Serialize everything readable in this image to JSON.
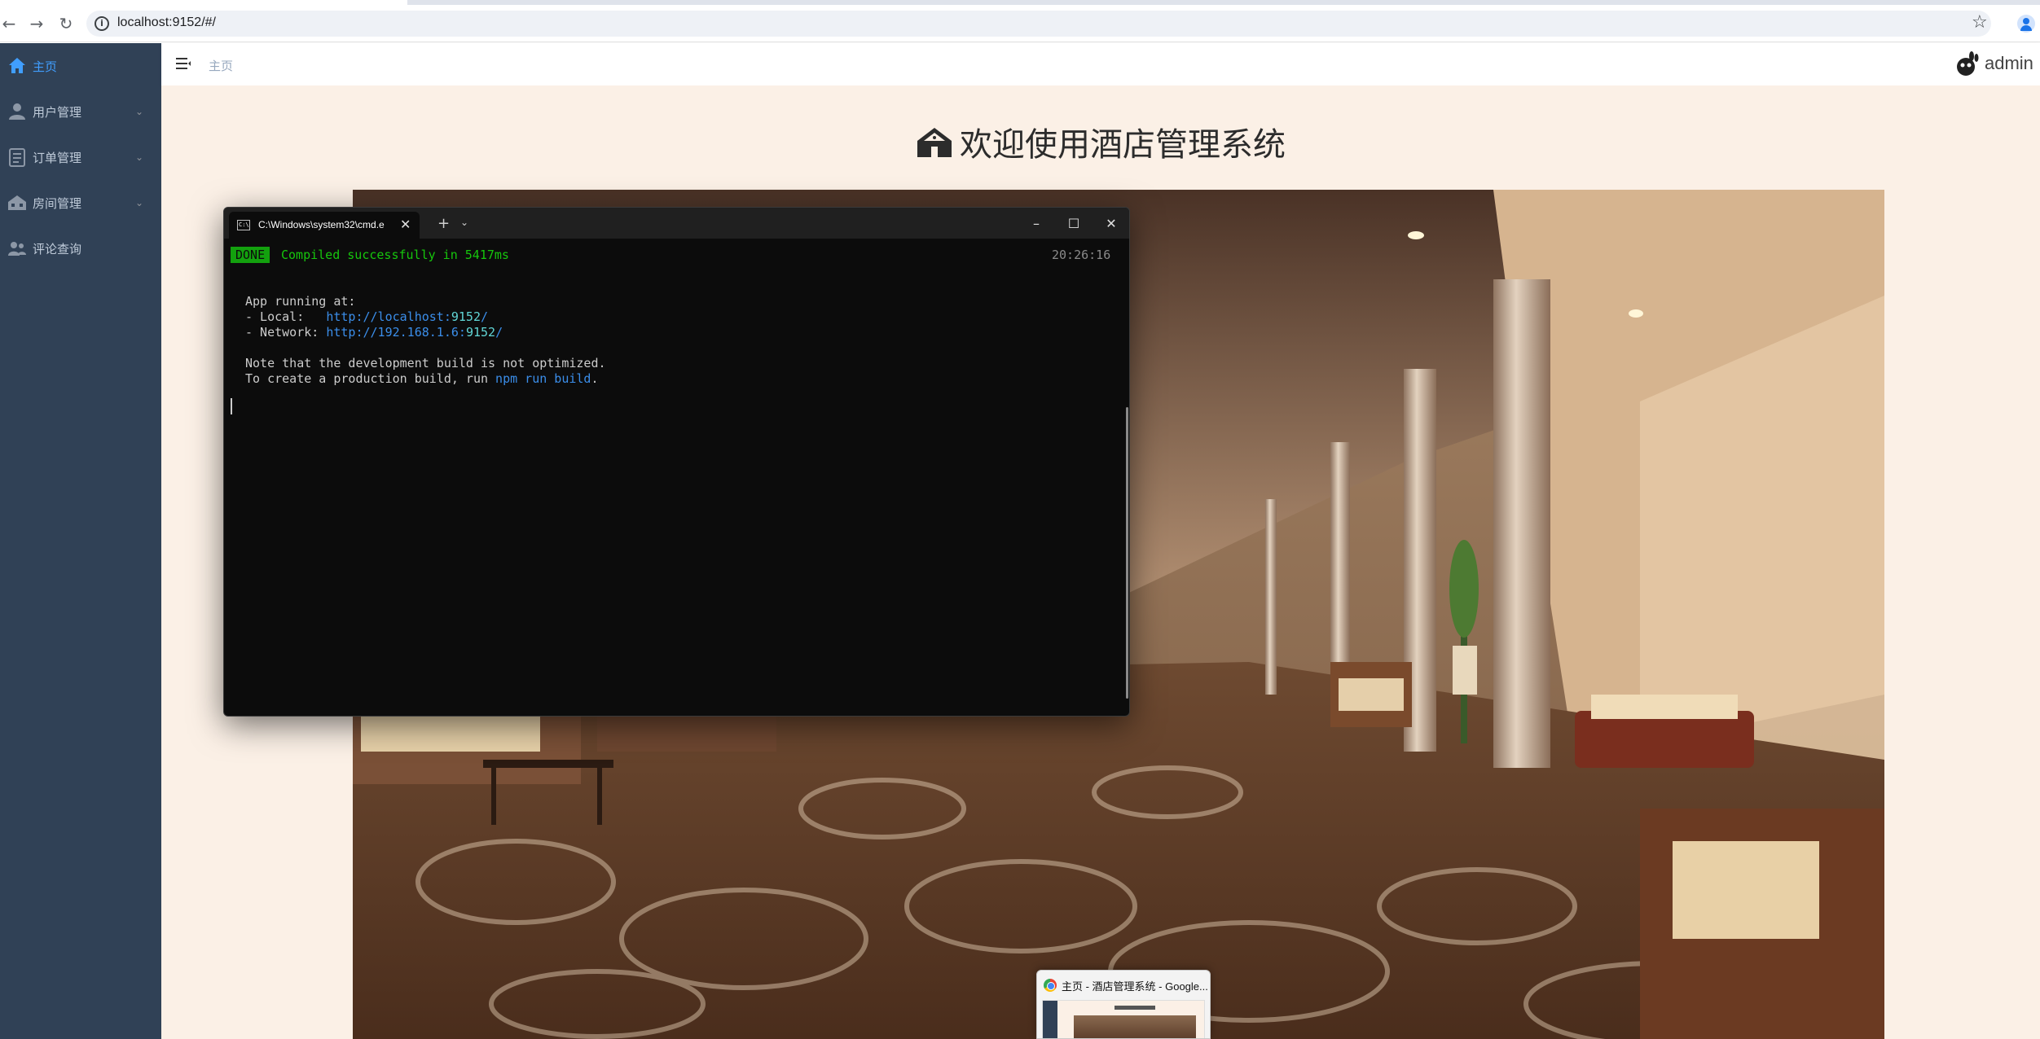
{
  "browser": {
    "url": "localhost:9152/#/"
  },
  "sidebar": {
    "items": [
      {
        "label": "主页",
        "icon": "home-icon",
        "active": true,
        "has_submenu": false
      },
      {
        "label": "用户管理",
        "icon": "users-icon",
        "active": false,
        "has_submenu": true
      },
      {
        "label": "订单管理",
        "icon": "order-icon",
        "active": false,
        "has_submenu": true
      },
      {
        "label": "房间管理",
        "icon": "room-icon",
        "active": false,
        "has_submenu": true
      },
      {
        "label": "评论查询",
        "icon": "comment-icon",
        "active": false,
        "has_submenu": false
      }
    ],
    "colors": {
      "background": "#304156",
      "text": "#bfcbd9",
      "active": "#409eff"
    }
  },
  "header": {
    "breadcrumb": "主页",
    "username": "admin"
  },
  "main": {
    "welcome_title": "欢迎使用酒店管理系统",
    "background": "#fbf0e6"
  },
  "terminal": {
    "tab_title": "C:\\Windows\\system32\\cmd.e",
    "done_badge": "DONE",
    "compiled_message": "Compiled successfully in 5417ms",
    "timestamp": "20:26:16",
    "lines": {
      "app_running": "App running at:",
      "local_prefix": "- Local:   ",
      "local_url": "http://localhost:",
      "local_port": "9152",
      "local_suffix": "/",
      "network_prefix": "- Network: ",
      "network_url": "http://192.168.1.6:",
      "network_port": "9152",
      "network_suffix": "/",
      "note": "Note that the development build is not optimized.",
      "prod_prefix": "To create a production build, run ",
      "prod_cmd": "npm run build",
      "prod_suffix": "."
    }
  },
  "taskbar_thumbnail": {
    "title": "主页 - 酒店管理系统 - Google..."
  }
}
